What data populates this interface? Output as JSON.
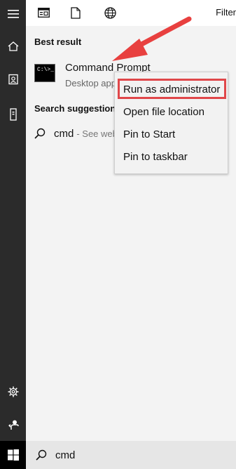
{
  "top_filters": {
    "apps_icon": "apps-filter-icon",
    "documents_icon": "documents-filter-icon",
    "web_icon": "web-filter-icon",
    "filters_label": "Filter"
  },
  "rail": {
    "menu_icon": "hamburger-icon",
    "home_icon": "home-icon",
    "documents_icon": "notebook-icon",
    "device_icon": "device-icon",
    "settings_icon": "gear-icon",
    "feedback_icon": "feedback-icon",
    "windows_icon": "windows-logo-icon"
  },
  "best_result": {
    "heading": "Best result",
    "title": "Command Prompt",
    "subtitle": "Desktop app",
    "icon_text": "C:\\>_"
  },
  "suggestions": {
    "heading": "Search suggestions",
    "items": [
      {
        "query": "cmd",
        "suffix": "- See web"
      }
    ]
  },
  "context_menu": {
    "items": [
      {
        "label": "Run as administrator",
        "highlighted": true
      },
      {
        "label": "Open file location"
      },
      {
        "label": "Pin to Start"
      },
      {
        "label": "Pin to taskbar"
      }
    ]
  },
  "search_box": {
    "query": "cmd"
  },
  "colors": {
    "rail_bg": "#2b2b2b",
    "panel_bg": "#f3f3f3",
    "highlight_border": "#e0474a",
    "annotation_arrow": "#e8403f"
  }
}
